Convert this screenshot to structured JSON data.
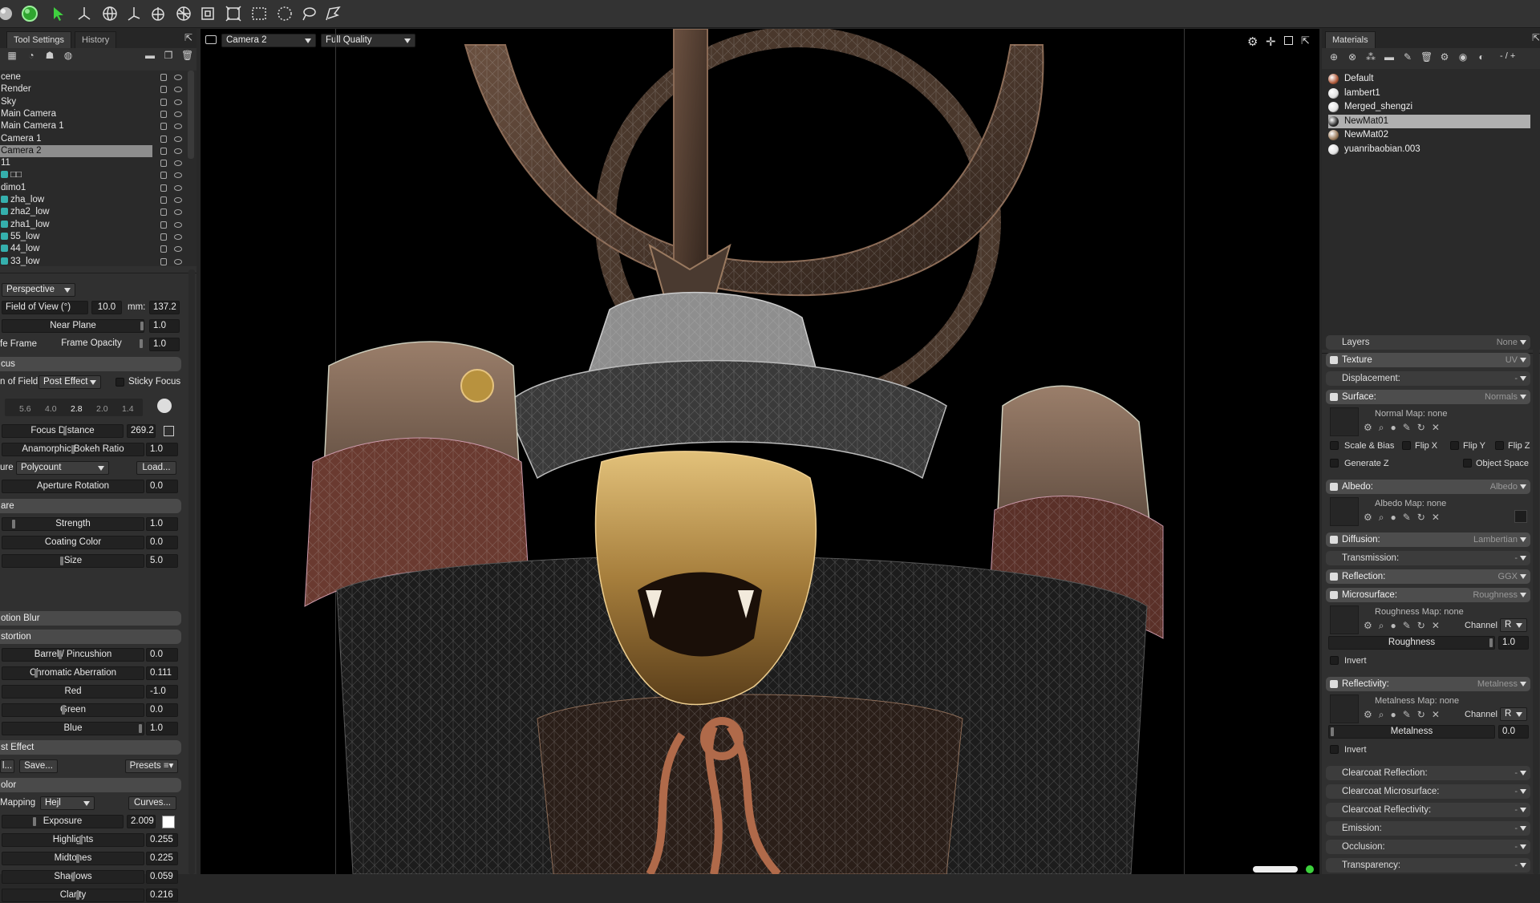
{
  "toolbar": {
    "icons": [
      "sphere-gray-icon",
      "sphere-green-icon",
      "select-arrow-icon",
      "translate-icon",
      "rotate-icon",
      "scale-icon",
      "globe-icon",
      "mesh-icon",
      "frame-icon",
      "frame-full-icon",
      "rect-select-icon",
      "circle-select-icon",
      "lasso-icon",
      "paint-select-icon"
    ]
  },
  "left": {
    "tabs": {
      "tool_settings": "Tool Settings",
      "history": "History"
    },
    "scene_items": [
      {
        "label": "cene",
        "indent": 0,
        "cube": false
      },
      {
        "label": "Render",
        "indent": 0,
        "cube": false
      },
      {
        "label": "Sky",
        "indent": 0,
        "cube": false
      },
      {
        "label": "Main Camera",
        "indent": 0,
        "cube": false
      },
      {
        "label": "Main Camera 1",
        "indent": 0,
        "cube": false
      },
      {
        "label": "Camera 1",
        "indent": 0,
        "cube": false
      },
      {
        "label": "Camera 2",
        "indent": 0,
        "cube": false,
        "selected": true
      },
      {
        "label": "11",
        "indent": 0,
        "cube": false
      },
      {
        "label": "□□",
        "indent": 0,
        "cube": true
      },
      {
        "label": "dimo1",
        "indent": 0,
        "cube": false
      },
      {
        "label": "zha_low",
        "indent": 0,
        "cube": true
      },
      {
        "label": "zha2_low",
        "indent": 0,
        "cube": true
      },
      {
        "label": "zha1_low",
        "indent": 0,
        "cube": true
      },
      {
        "label": "55_low",
        "indent": 0,
        "cube": true
      },
      {
        "label": "44_low",
        "indent": 0,
        "cube": true
      },
      {
        "label": "33_low",
        "indent": 0,
        "cube": true
      }
    ],
    "camera": {
      "projection": "Perspective",
      "fov_label": "Field of View (°)",
      "fov_value": "10.0",
      "mm_label": "mm:",
      "mm_value": "137.2",
      "near_plane_label": "Near Plane",
      "near_plane_value": "1.0",
      "safe_frame_label": "fe Frame",
      "frame_opacity_label": "Frame Opacity",
      "frame_opacity_value": "1.0"
    },
    "focus": {
      "header": "cus",
      "dof_label": "n of Field",
      "dof_mode": "Post Effect",
      "sticky_focus": "Sticky Focus",
      "fstops": [
        "5.6",
        "4.0",
        "2.8",
        "2.0",
        "1.4"
      ],
      "focus_distance_label": "Focus Distance",
      "focus_distance_value": "269.2",
      "bokeh_label": "Anamorphic Bokeh Ratio",
      "bokeh_value": "1.0",
      "aperture_label": "ure",
      "aperture_shape": "Polycount",
      "load_label": "Load...",
      "aperture_rotation_label": "Aperture Rotation",
      "aperture_rotation_value": "0.0"
    },
    "flare": {
      "header": "are",
      "strength_label": "Strength",
      "strength_value": "1.0",
      "coating_label": "Coating Color",
      "coating_value": "0.0",
      "size_label": "Size",
      "size_value": "5.0"
    },
    "motion_blur_header": "otion Blur",
    "distortion": {
      "header": "stortion",
      "barrel_label": "Barrel / Pincushion",
      "barrel_value": "0.0",
      "chromatic_label": "Chromatic Aberration",
      "chromatic_value": "0.111",
      "red_label": "Red",
      "red_value": "-1.0",
      "green_label": "Green",
      "green_value": "0.0",
      "blue_label": "Blue",
      "blue_value": "1.0"
    },
    "post_effect": {
      "header": "st Effect",
      "load_label": "l...",
      "save_label": "Save...",
      "presets_label": "Presets"
    },
    "color": {
      "header": "olor",
      "mapping_label": "Mapping",
      "mapping_value": "Hejl",
      "curves_label": "Curves...",
      "exposure_label": "Exposure",
      "exposure_value": "2.009",
      "highlights_label": "Highlights",
      "highlights_value": "0.255",
      "midtones_label": "Midtones",
      "midtones_value": "0.225",
      "shadows_label": "Shadows",
      "shadows_value": "0.059",
      "clarity_label": "Clarity",
      "clarity_value": "0.216"
    }
  },
  "viewport": {
    "camera_select": "Camera 2",
    "quality_select": "Full Quality"
  },
  "right": {
    "tab": "Materials",
    "counter": "- / +",
    "materials": [
      {
        "name": "Default",
        "color": "#b05a3a"
      },
      {
        "name": "lambert1",
        "color": "#e0e0e0"
      },
      {
        "name": "Merged_shengzi",
        "color": "#e0e0e0"
      },
      {
        "name": "NewMat01",
        "color": "#2a2a2a",
        "selected": true
      },
      {
        "name": "NewMat02",
        "color": "#9a7a5a"
      },
      {
        "name": "yuanribaobian.003",
        "color": "#e0e0e0"
      }
    ],
    "layers": {
      "label": "Layers",
      "value": "None"
    },
    "texture": {
      "label": "Texture",
      "value": "UV"
    },
    "displacement": {
      "label": "Displacement:",
      "value": "-"
    },
    "surface": {
      "label": "Surface:",
      "value": "Normals"
    },
    "normal_map": "Normal Map: none",
    "scale_bias": "Scale & Bias",
    "flip_x": "Flip X",
    "flip_y": "Flip Y",
    "flip_z": "Flip Z",
    "generate_z": "Generate Z",
    "object_space": "Object Space",
    "albedo": {
      "label": "Albedo:",
      "value": "Albedo"
    },
    "albedo_map": "Albedo Map: none",
    "diffusion": {
      "label": "Diffusion:",
      "value": "Lambertian"
    },
    "transmission": {
      "label": "Transmission:",
      "value": "-"
    },
    "reflection": {
      "label": "Reflection:",
      "value": "GGX"
    },
    "microsurface": {
      "label": "Microsurface:",
      "value": "Roughness"
    },
    "roughness_map": "Roughness Map: none",
    "channel_label": "Channel",
    "channel_value": "R",
    "roughness_label": "Roughness",
    "roughness_value": "1.0",
    "invert": "Invert",
    "reflectivity": {
      "label": "Reflectivity:",
      "value": "Metalness"
    },
    "metalness_map": "Metalness Map: none",
    "metalness_label": "Metalness",
    "metalness_value": "0.0",
    "clearcoat_reflection": {
      "label": "Clearcoat Reflection:",
      "value": "-"
    },
    "clearcoat_microsurface": {
      "label": "Clearcoat Microsurface:",
      "value": "-"
    },
    "clearcoat_reflectivity": {
      "label": "Clearcoat Reflectivity:",
      "value": "-"
    },
    "emission": {
      "label": "Emission:",
      "value": "-"
    },
    "occlusion": {
      "label": "Occlusion:",
      "value": "-"
    },
    "transparency": {
      "label": "Transparency:",
      "value": "-"
    }
  }
}
